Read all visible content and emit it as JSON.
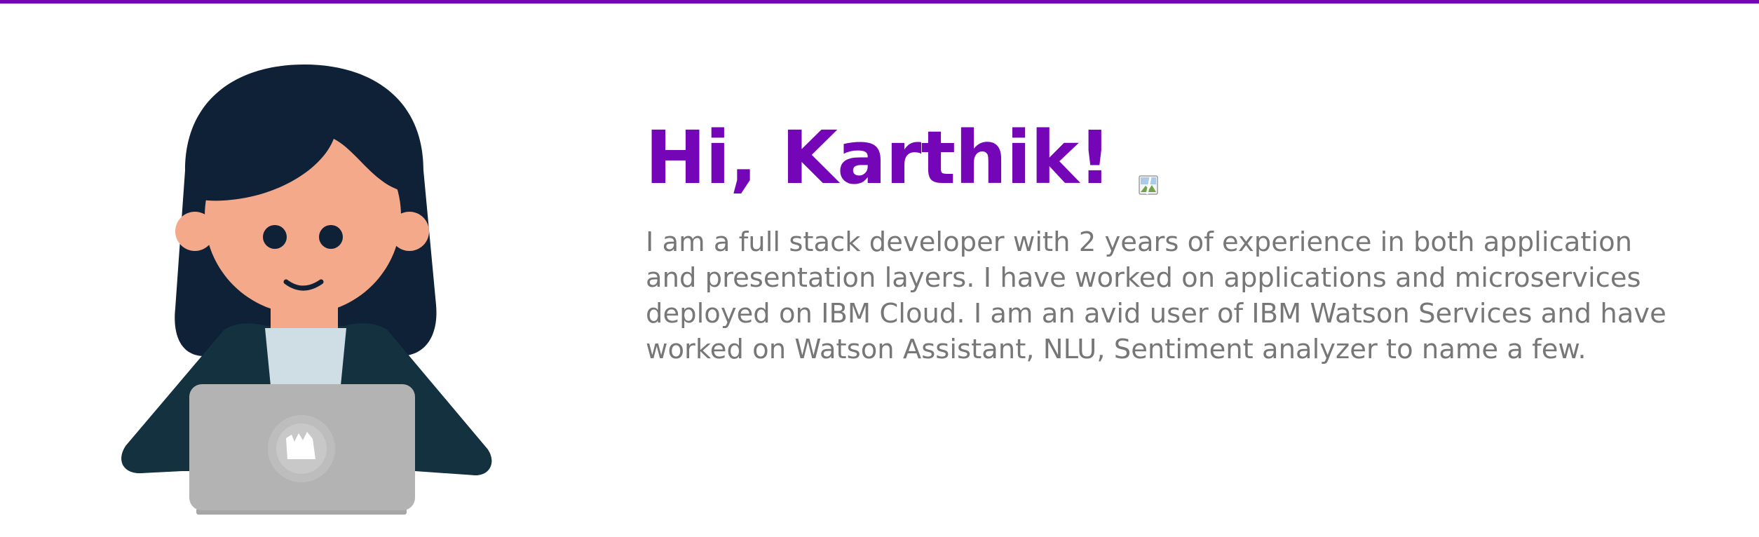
{
  "theme": {
    "accent": "#7506b8",
    "text_muted": "#777777",
    "hair": "#0f2136",
    "skin": "#f3a98a",
    "jacket": "#13313f",
    "shirt": "#cfdde5",
    "laptop": "#b3b3b3"
  },
  "hero": {
    "greeting": "Hi, Karthik!",
    "wave_icon": "broken-image-icon",
    "bio": "I am a full stack developer with 2 years of experience in both application and presentation layers. I have worked on applications and microservices deployed on IBM Cloud. I am an avid user of IBM Watson Services and have worked on Watson Assistant, NLU, Sentiment analyzer to name a few."
  },
  "illustration": {
    "subject": "developer-avatar-illustration"
  }
}
